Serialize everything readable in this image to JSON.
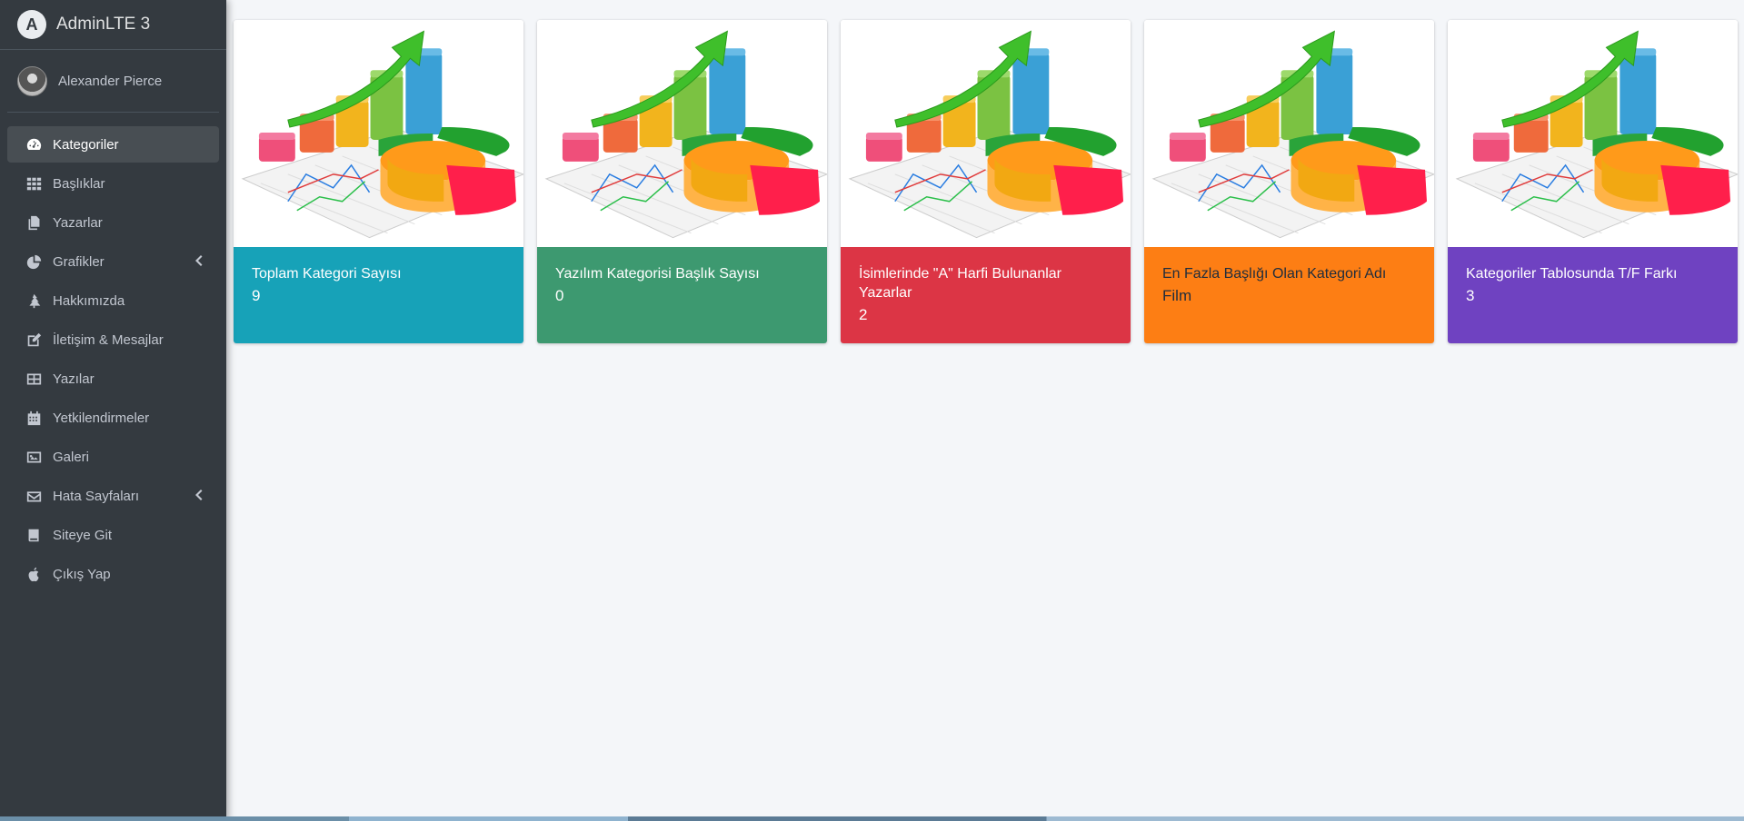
{
  "brand": {
    "logo_letter": "A",
    "name": "AdminLTE 3"
  },
  "user": {
    "name": "Alexander Pierce"
  },
  "nav": [
    {
      "label": "Kategoriler",
      "icon": "tachometer-icon",
      "active": true,
      "has_chevron": false
    },
    {
      "label": "Başlıklar",
      "icon": "grid-icon",
      "active": false,
      "has_chevron": false
    },
    {
      "label": "Yazarlar",
      "icon": "copy-icon",
      "active": false,
      "has_chevron": false
    },
    {
      "label": "Grafikler",
      "icon": "pie-chart-icon",
      "active": false,
      "has_chevron": true
    },
    {
      "label": "Hakkımızda",
      "icon": "tree-icon",
      "active": false,
      "has_chevron": false
    },
    {
      "label": "İletişim & Mesajlar",
      "icon": "edit-icon",
      "active": false,
      "has_chevron": false
    },
    {
      "label": "Yazılar",
      "icon": "table-icon",
      "active": false,
      "has_chevron": false
    },
    {
      "label": "Yetkilendirmeler",
      "icon": "calendar-icon",
      "active": false,
      "has_chevron": false
    },
    {
      "label": "Galeri",
      "icon": "image-icon",
      "active": false,
      "has_chevron": false
    },
    {
      "label": "Hata Sayfaları",
      "icon": "envelope-icon",
      "active": false,
      "has_chevron": true
    },
    {
      "label": "Siteye Git",
      "icon": "book-icon",
      "active": false,
      "has_chevron": false
    },
    {
      "label": "Çıkış Yap",
      "icon": "apple-icon",
      "active": false,
      "has_chevron": false
    }
  ],
  "cards": [
    {
      "title": "Toplam Kategori Sayısı",
      "value": "9",
      "color": "#17a2b8"
    },
    {
      "title": "Yazılım Kategorisi Başlık Sayısı",
      "value": "0",
      "color": "#3d9970"
    },
    {
      "title": "İsimlerinde \"A\" Harfi Bulunanlar Yazarlar",
      "value": "2",
      "color": "#dc3545"
    },
    {
      "title": "En Fazla Başlığı Olan Kategori Adı",
      "value": "Film",
      "color": "#fd7e14"
    },
    {
      "title": "Kategoriler Tablosunda T/F Farkı",
      "value": "3",
      "color": "#6f42c1"
    }
  ]
}
